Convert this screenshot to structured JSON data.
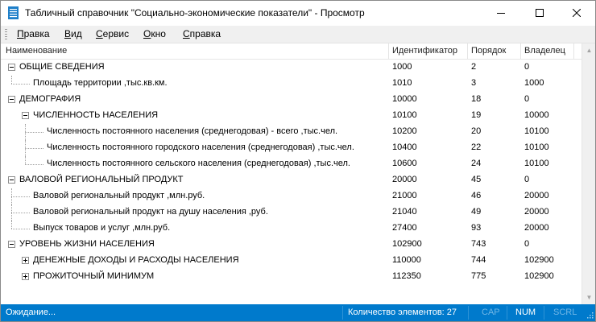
{
  "window": {
    "title": "Табличный справочник \"Социально-экономические показатели\" - Просмотр"
  },
  "menu": {
    "items": [
      {
        "label": "Правка"
      },
      {
        "label": "Вид"
      },
      {
        "label": "Сервис"
      },
      {
        "label": "Окно"
      },
      {
        "label": "Справка"
      }
    ]
  },
  "columns": {
    "name": "Наименование",
    "id": "Идентификатор",
    "order": "Порядок",
    "owner": "Владелец"
  },
  "rows": [
    {
      "name": "ОБЩИЕ СВЕДЕНИЯ",
      "id": "1000",
      "order": "2",
      "owner": "0",
      "level": 0,
      "expander": "expanded"
    },
    {
      "name": "Площадь территории ,тыс.кв.км.",
      "id": "1010",
      "order": "3",
      "owner": "1000",
      "level": 1,
      "expander": "none"
    },
    {
      "name": "ДЕМОГРАФИЯ",
      "id": "10000",
      "order": "18",
      "owner": "0",
      "level": 0,
      "expander": "expanded"
    },
    {
      "name": "ЧИСЛЕННОСТЬ НАСЕЛЕНИЯ",
      "id": "10100",
      "order": "19",
      "owner": "10000",
      "level": 1,
      "expander": "expanded"
    },
    {
      "name": "Численность постоянного населения (среднегодовая) - всего ,тыс.чел.",
      "id": "10200",
      "order": "20",
      "owner": "10100",
      "level": 2,
      "expander": "none"
    },
    {
      "name": "Численность постоянного городского населения (среднегодовая) ,тыс.чел.",
      "id": "10400",
      "order": "22",
      "owner": "10100",
      "level": 2,
      "expander": "none"
    },
    {
      "name": "Численность постоянного сельского населения (среднегодовая) ,тыс.чел.",
      "id": "10600",
      "order": "24",
      "owner": "10100",
      "level": 2,
      "expander": "none"
    },
    {
      "name": "ВАЛОВОЙ РЕГИОНАЛЬНЫЙ ПРОДУКТ",
      "id": "20000",
      "order": "45",
      "owner": "0",
      "level": 0,
      "expander": "expanded"
    },
    {
      "name": "Валовой региональный продукт ,млн.руб.",
      "id": "21000",
      "order": "46",
      "owner": "20000",
      "level": 1,
      "expander": "none"
    },
    {
      "name": "Валовой региональный продукт на душу населения ,руб.",
      "id": "21040",
      "order": "49",
      "owner": "20000",
      "level": 1,
      "expander": "none"
    },
    {
      "name": "Выпуск товаров и услуг ,млн.руб.",
      "id": "27400",
      "order": "93",
      "owner": "20000",
      "level": 1,
      "expander": "none"
    },
    {
      "name": "УРОВЕНЬ ЖИЗНИ НАСЕЛЕНИЯ",
      "id": "102900",
      "order": "743",
      "owner": "0",
      "level": 0,
      "expander": "expanded"
    },
    {
      "name": "ДЕНЕЖНЫЕ ДОХОДЫ И РАСХОДЫ НАСЕЛЕНИЯ",
      "id": "110000",
      "order": "744",
      "owner": "102900",
      "level": 1,
      "expander": "collapsed"
    },
    {
      "name": "ПРОЖИТОЧНЫЙ МИНИМУМ",
      "id": "112350",
      "order": "775",
      "owner": "102900",
      "level": 1,
      "expander": "collapsed"
    }
  ],
  "status": {
    "state": "Ожидание...",
    "count": "Количество элементов: 27",
    "cap": "CAP",
    "num": "NUM",
    "scrl": "SCRL"
  },
  "icons": {
    "app": "table-directory-icon",
    "expanded": "minus-box-icon",
    "collapsed": "plus-box-icon"
  },
  "colors": {
    "statusbar": "#007acc",
    "menubar": "#f0f0f0",
    "app_icon": "#1e7fc9"
  }
}
